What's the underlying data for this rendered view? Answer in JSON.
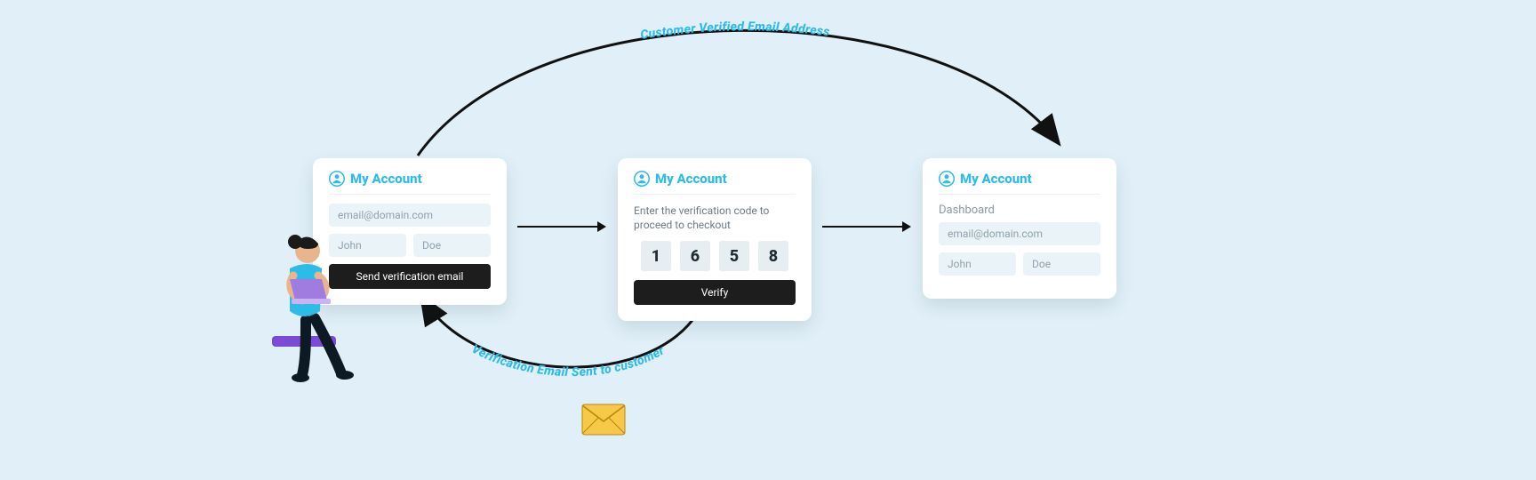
{
  "labels": {
    "top_curve": "Customer Verified Email Address",
    "bottom_curve": "Verification Email Sent to customer"
  },
  "card1": {
    "title": "My Account",
    "email": "email@domain.com",
    "first_name": "John",
    "last_name": "Doe",
    "button": "Send verification email"
  },
  "card2": {
    "title": "My Account",
    "subtitle": "Enter the verification code to proceed to checkout",
    "code": [
      "1",
      "6",
      "5",
      "8"
    ],
    "button": "Verify"
  },
  "card3": {
    "title": "My Account",
    "dashboard": "Dashboard",
    "email": "email@domain.com",
    "first_name": "John",
    "last_name": "Doe"
  }
}
